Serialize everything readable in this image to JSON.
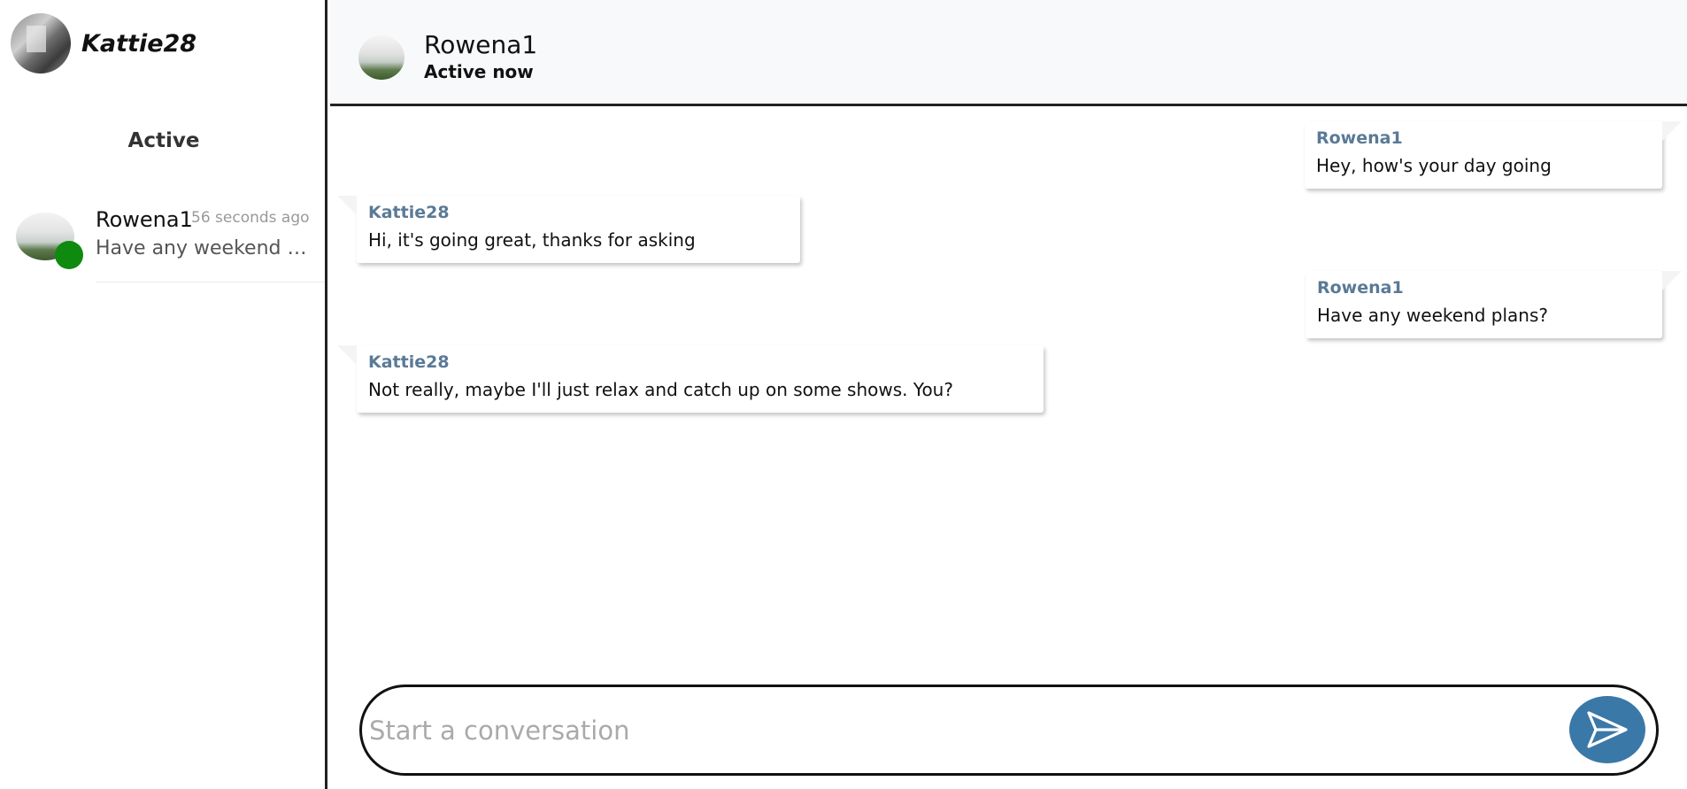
{
  "current_user": {
    "name": "Kattie28"
  },
  "sidebar": {
    "section_label": "Active",
    "contacts": [
      {
        "name": "Rowena1",
        "time": "56 seconds ago",
        "preview": "Have any weekend plans?",
        "online": true
      }
    ]
  },
  "chat": {
    "header": {
      "name": "Rowena1",
      "status": "Active now"
    },
    "messages": [
      {
        "sender": "Rowena1",
        "text": "Hey, how's your day going",
        "side": "right"
      },
      {
        "sender": "Kattie28",
        "text": "Hi, it's going great, thanks for asking",
        "side": "left"
      },
      {
        "sender": "Rowena1",
        "text": "Have any weekend plans?",
        "side": "right"
      },
      {
        "sender": "Kattie28",
        "text": "Not really, maybe I'll just relax and catch up on some shows. You?",
        "side": "left"
      }
    ]
  },
  "composer": {
    "placeholder": "Start a conversation",
    "value": ""
  },
  "icons": {
    "send": "send-icon"
  },
  "colors": {
    "sender_name": "#5a7a96",
    "send_button": "#3a78a8",
    "online": "#0e8a0e"
  }
}
